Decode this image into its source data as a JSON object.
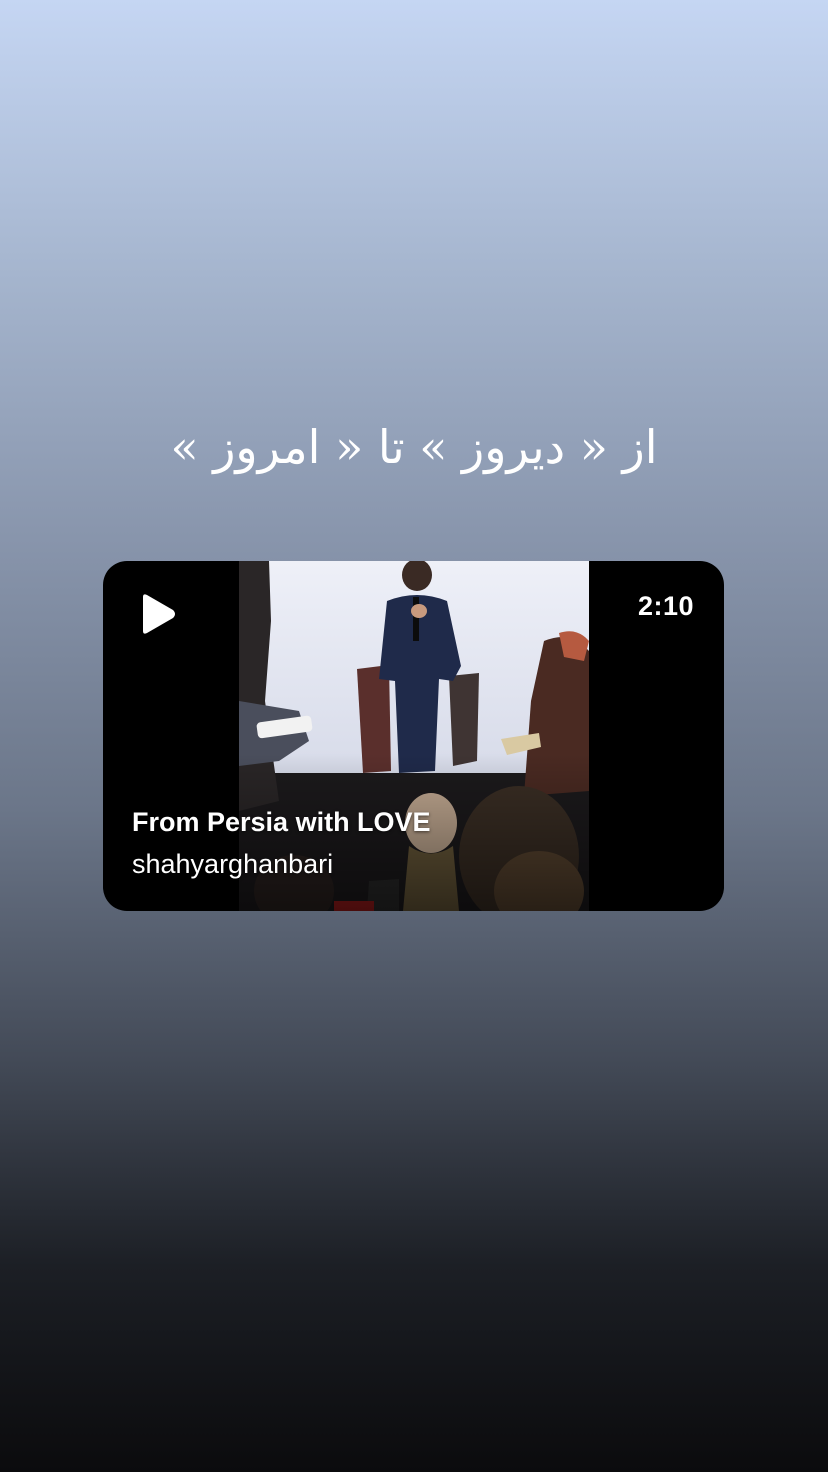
{
  "story": {
    "caption": "از « دیروز » تا « امروز »"
  },
  "video_card": {
    "title": "From Persia with LOVE",
    "username": "shahyarghanbari",
    "duration": "2:10",
    "play_icon": "play-icon"
  }
}
